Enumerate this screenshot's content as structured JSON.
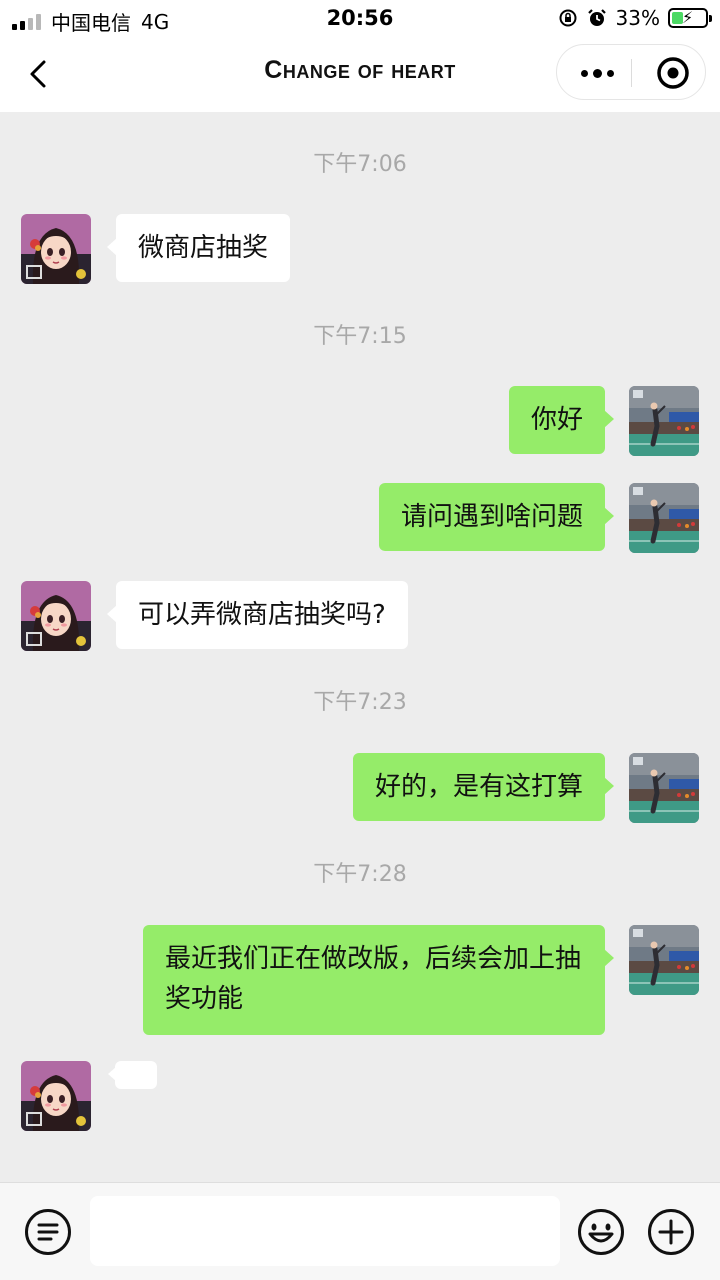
{
  "status_bar": {
    "carrier": "中国电信",
    "network": "4G",
    "time": "20:56",
    "battery_percent": "33%",
    "battery_level": 0.33
  },
  "nav": {
    "title": "Change of heart"
  },
  "messages": [
    {
      "type": "time",
      "text": "下午7:06"
    },
    {
      "type": "in",
      "text": "微商店抽奖"
    },
    {
      "type": "time",
      "text": "下午7:15"
    },
    {
      "type": "out",
      "text": "你好"
    },
    {
      "type": "out",
      "text": "请问遇到啥问题"
    },
    {
      "type": "in",
      "text": "可以弄微商店抽奖吗?"
    },
    {
      "type": "time",
      "text": "下午7:23"
    },
    {
      "type": "out",
      "text": "好的，是有这打算"
    },
    {
      "type": "time",
      "text": "下午7:28"
    },
    {
      "type": "out",
      "text": "最近我们正在做改版，后续会加上抽奖功能"
    },
    {
      "type": "in",
      "text": ""
    }
  ],
  "input": {
    "value": "",
    "placeholder": ""
  },
  "icons": {
    "back": "chevron-left-icon",
    "more": "more-dots-icon",
    "close": "target-close-icon",
    "voice": "voice-icon",
    "emoji": "emoji-icon",
    "add": "add-circle-icon"
  },
  "colors": {
    "outgoing_bubble": "#95ec69",
    "incoming_bubble": "#ffffff",
    "background": "#ededed",
    "battery_fill": "#4cd964"
  }
}
